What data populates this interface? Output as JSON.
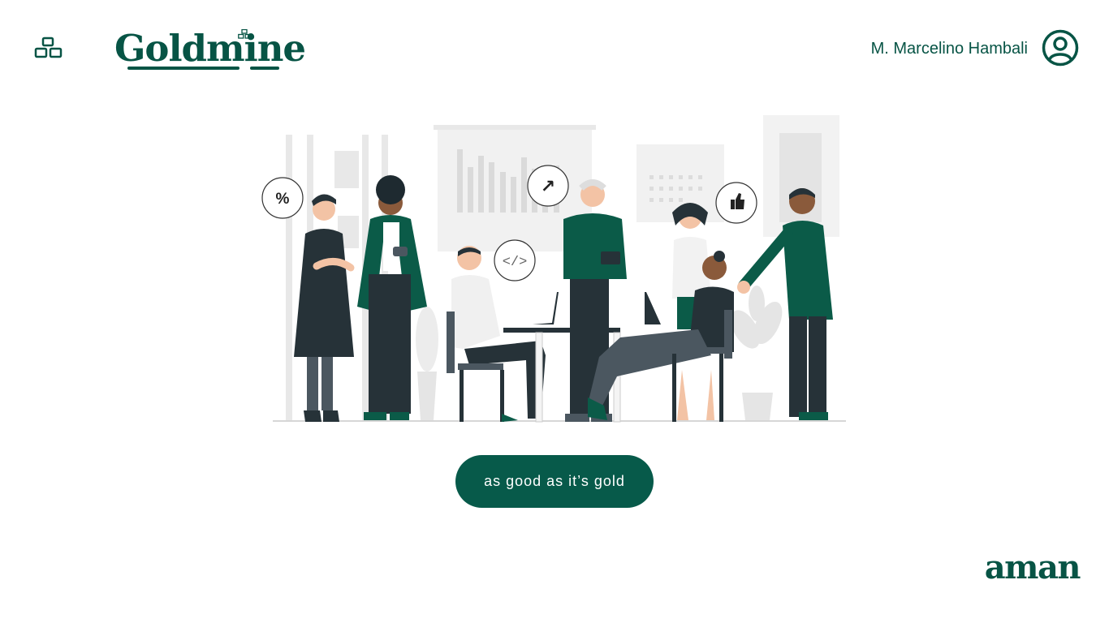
{
  "header": {
    "app_title": "Goldmine",
    "user_name": "M. Marcelino Hambali",
    "icons": {
      "menu_icon": "gold-bars-icon",
      "profile_icon": "user-circle-icon"
    }
  },
  "illustration": {
    "bubbles": {
      "percent": "%",
      "arrow": "↗",
      "code": "</>",
      "thumbs": "👍"
    }
  },
  "main": {
    "cta_label": "as good as it’s gold"
  },
  "footer": {
    "brand": "aman"
  },
  "colors": {
    "primary": "#075445",
    "button": "#075a4a",
    "background": "#ffffff"
  }
}
